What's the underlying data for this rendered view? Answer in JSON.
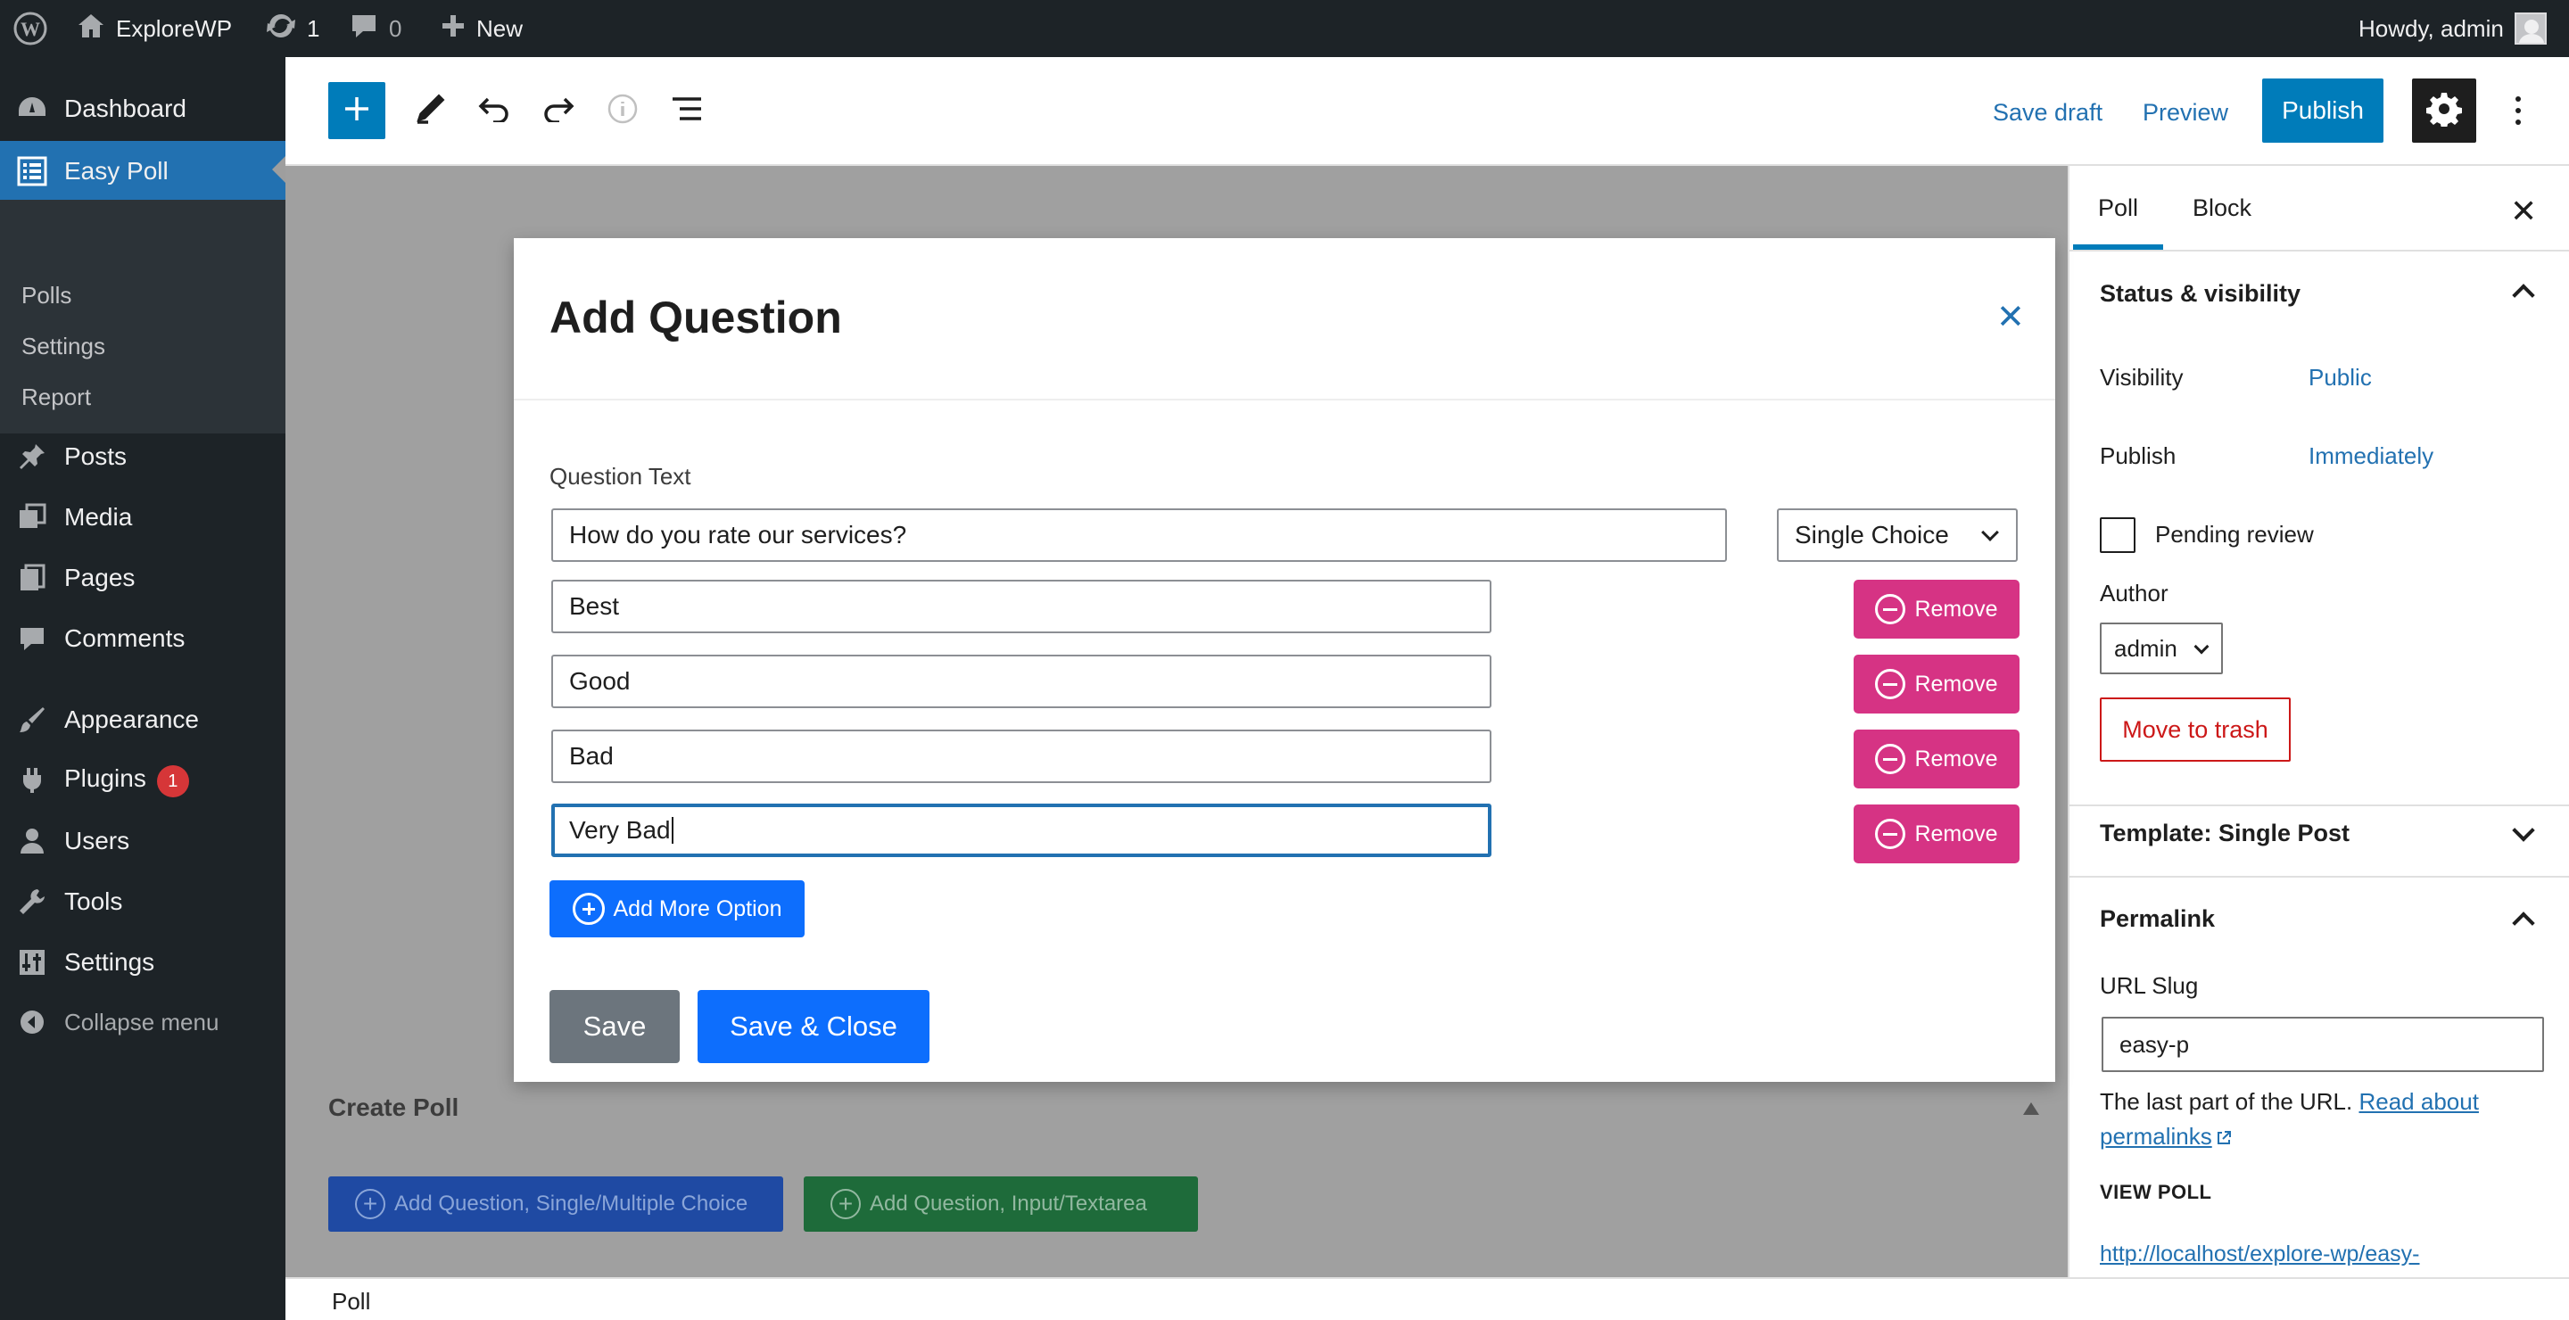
{
  "admin_bar": {
    "site_name": "ExploreWP",
    "updates_count": "1",
    "comments_count": "0",
    "new_label": "New",
    "greeting": "Howdy, admin",
    "icons": [
      "wordpress-logo-icon",
      "home-icon",
      "updates-icon",
      "comment-icon",
      "plus-icon",
      "avatar"
    ]
  },
  "sidebar": {
    "items": [
      {
        "label": "Dashboard",
        "icon": "dashboard-icon"
      },
      {
        "label": "Easy Poll",
        "icon": "list-icon",
        "active": true
      },
      {
        "label": "Posts",
        "icon": "pin-icon"
      },
      {
        "label": "Media",
        "icon": "media-icon"
      },
      {
        "label": "Pages",
        "icon": "pages-icon"
      },
      {
        "label": "Comments",
        "icon": "comment-icon"
      },
      {
        "label": "Appearance",
        "icon": "brush-icon"
      },
      {
        "label": "Plugins",
        "icon": "plug-icon",
        "badge": "1"
      },
      {
        "label": "Users",
        "icon": "user-icon"
      },
      {
        "label": "Tools",
        "icon": "wrench-icon"
      },
      {
        "label": "Settings",
        "icon": "sliders-icon"
      }
    ],
    "submenu": [
      "Polls",
      "Settings",
      "Report"
    ],
    "collapse_label": "Collapse menu"
  },
  "header": {
    "save_draft": "Save draft",
    "preview": "Preview",
    "publish": "Publish",
    "toolbar_icons": [
      "plus-icon",
      "pencil-icon",
      "undo-icon",
      "redo-icon",
      "info-icon",
      "list-view-icon",
      "gear-icon",
      "more-vertical-icon"
    ]
  },
  "canvas": {
    "create_poll_title": "Create Poll",
    "add_choice_button": "Add Question, Single/Multiple Choice",
    "add_input_button": "Add Question, Input/Textarea"
  },
  "footer": {
    "breadcrumb": "Poll"
  },
  "settings": {
    "tabs": [
      "Poll",
      "Block"
    ],
    "status_title": "Status & visibility",
    "visibility_label": "Visibility",
    "visibility_value": "Public",
    "publish_label": "Publish",
    "publish_value": "Immediately",
    "pending_review": "Pending review",
    "author_label": "Author",
    "author_value": "admin",
    "trash_button": "Move to trash",
    "template_label": "Template: Single Post",
    "permalink_title": "Permalink",
    "url_slug_label": "URL Slug",
    "url_slug_value": "easy-p",
    "help_text": "The last part of the URL.",
    "help_link": "Read about",
    "help_link2": "permalinks",
    "view_poll_label": "VIEW POLL",
    "view_poll_link": "http://localhost/explore-wp/easy-"
  },
  "modal": {
    "title": "Add Question",
    "question_label": "Question Text",
    "question_value": "How do you rate our services?",
    "type_value": "Single Choice",
    "options": [
      "Best",
      "Good",
      "Bad",
      "Very Bad"
    ],
    "remove_label": "Remove",
    "add_more_option": "Add More Option",
    "save": "Save",
    "save_close": "Save & Close"
  },
  "colors": {
    "admin_dark": "#1d2327",
    "wp_blue": "#007cba",
    "remove_pink": "#d63384",
    "primary_blue": "#0d6efd",
    "secondary_gray": "#6c757d",
    "danger_red": "#cc1818"
  }
}
